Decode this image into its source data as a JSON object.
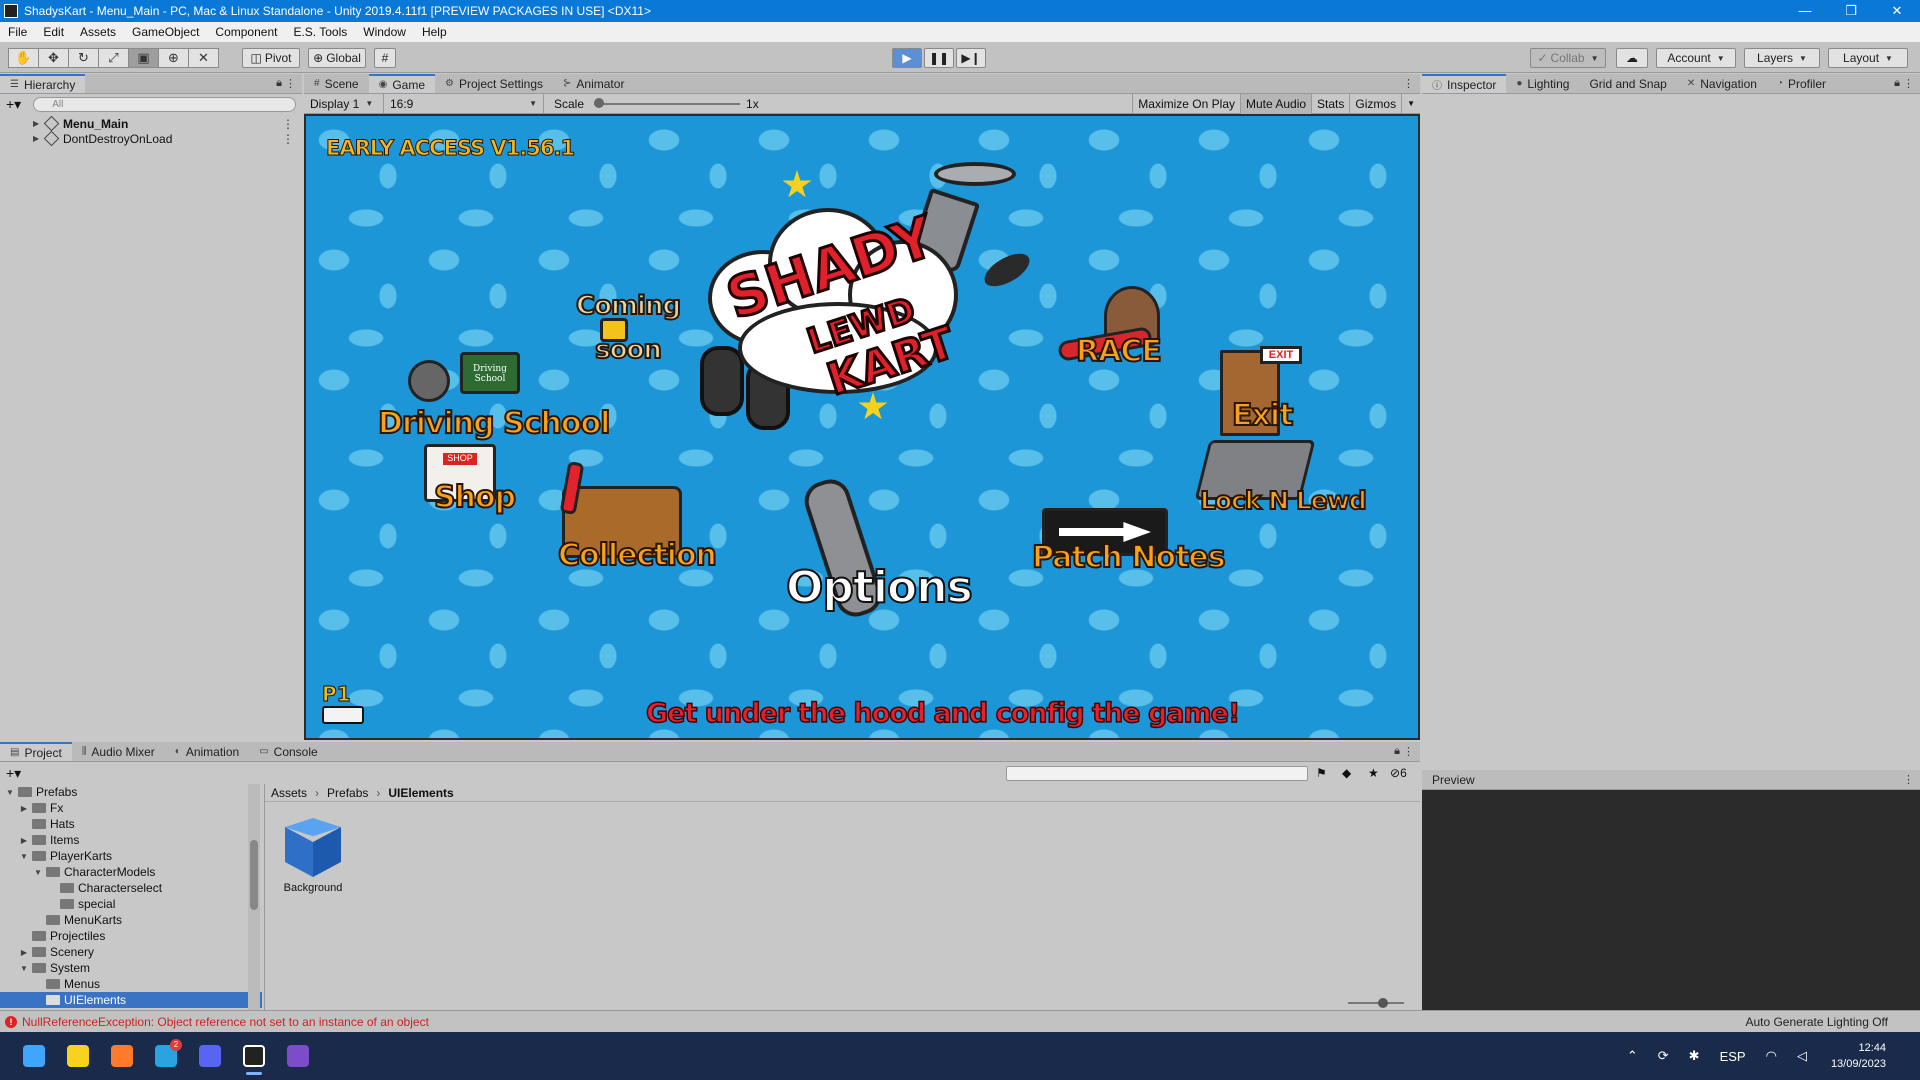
{
  "window": {
    "title": "ShadysKart - Menu_Main - PC, Mac & Linux Standalone - Unity 2019.4.11f1 [PREVIEW PACKAGES IN USE] <DX11>",
    "controls": [
      "—",
      "❐",
      "✕"
    ]
  },
  "menu": [
    "File",
    "Edit",
    "Assets",
    "GameObject",
    "Component",
    "E.S. Tools",
    "Window",
    "Help"
  ],
  "toolbar": {
    "pivot": "Pivot",
    "global": "Global",
    "collab": "Collab",
    "account": "Account",
    "layers": "Layers",
    "layout": "Layout"
  },
  "hierarchy": {
    "tab": "Hierarchy",
    "search_placeholder": "All",
    "items": [
      "Menu_Main",
      "DontDestroyOnLoad"
    ]
  },
  "center_tabs": [
    "Scene",
    "Game",
    "Project Settings",
    "Animator"
  ],
  "game_toolbar": {
    "display": "Display 1",
    "aspect": "16:9",
    "scale_label": "Scale",
    "scale_value": "1x",
    "maximize": "Maximize On Play",
    "mute": "Mute Audio",
    "stats": "Stats",
    "gizmos": "Gizmos"
  },
  "game": {
    "version": "EARLY ACCESS V1.56.1",
    "logo_line1": "SHADY",
    "logo_line2": "LEWD",
    "logo_line3": "KART",
    "coming_1": "Coming",
    "coming_2": "soon",
    "school_sign": "Driving School",
    "shop_sign": "SHOP",
    "exit_sign": "EXIT",
    "p1": "P1",
    "buttons": {
      "driving_school": "Driving School",
      "shop": "Shop",
      "collection": "Collection",
      "options": "Options",
      "race": "RACE",
      "exit": "Exit",
      "lock_n_lewd": "Lock N Lewd",
      "patch_notes": "Patch Notes"
    },
    "tagline": "Get under the hood and config the game!"
  },
  "inspector_tabs": [
    "Inspector",
    "Lighting",
    "Grid and Snap",
    "Navigation",
    "Profiler"
  ],
  "preview_label": "Preview",
  "bottom_tabs": [
    "Project",
    "Audio Mixer",
    "Animation",
    "Console"
  ],
  "project": {
    "hidden_count": "6",
    "tree": [
      {
        "label": "Prefabs",
        "indent": 1,
        "arrow": "▼"
      },
      {
        "label": "Fx",
        "indent": 2,
        "arrow": "▶"
      },
      {
        "label": "Hats",
        "indent": 2,
        "arrow": ""
      },
      {
        "label": "Items",
        "indent": 2,
        "arrow": "▶"
      },
      {
        "label": "PlayerKarts",
        "indent": 2,
        "arrow": "▼"
      },
      {
        "label": "CharacterModels",
        "indent": 3,
        "arrow": "▼"
      },
      {
        "label": "Characterselect",
        "indent": 4,
        "arrow": ""
      },
      {
        "label": "special",
        "indent": 4,
        "arrow": ""
      },
      {
        "label": "MenuKarts",
        "indent": 3,
        "arrow": ""
      },
      {
        "label": "Projectiles",
        "indent": 2,
        "arrow": ""
      },
      {
        "label": "Scenery",
        "indent": 2,
        "arrow": "▶"
      },
      {
        "label": "System",
        "indent": 2,
        "arrow": "▼"
      },
      {
        "label": "Menus",
        "indent": 3,
        "arrow": ""
      },
      {
        "label": "UIElements",
        "indent": 3,
        "arrow": "",
        "selected": true
      }
    ],
    "breadcrumb": [
      "Assets",
      "Prefabs",
      "UIElements"
    ],
    "assets": [
      "Background"
    ]
  },
  "status": {
    "error": "NullReferenceException: Object reference not set to an instance of an object",
    "right": "Auto Generate Lighting Off"
  },
  "taskbar": {
    "apps": [
      {
        "name": "windows-start-icon",
        "color": "#3ea6ff"
      },
      {
        "name": "sticky-notes-icon",
        "color": "#f7d21e"
      },
      {
        "name": "firefox-icon",
        "color": "#ff7a2a"
      },
      {
        "name": "telegram-icon",
        "color": "#2aa3e0",
        "badge": "2"
      },
      {
        "name": "discord-icon",
        "color": "#5865f2"
      },
      {
        "name": "unity-icon",
        "color": "#222222",
        "active": true
      },
      {
        "name": "visual-studio-icon",
        "color": "#7d4cc8"
      }
    ],
    "lang": "ESP",
    "time": "12:44",
    "date": "13/09/2023"
  }
}
